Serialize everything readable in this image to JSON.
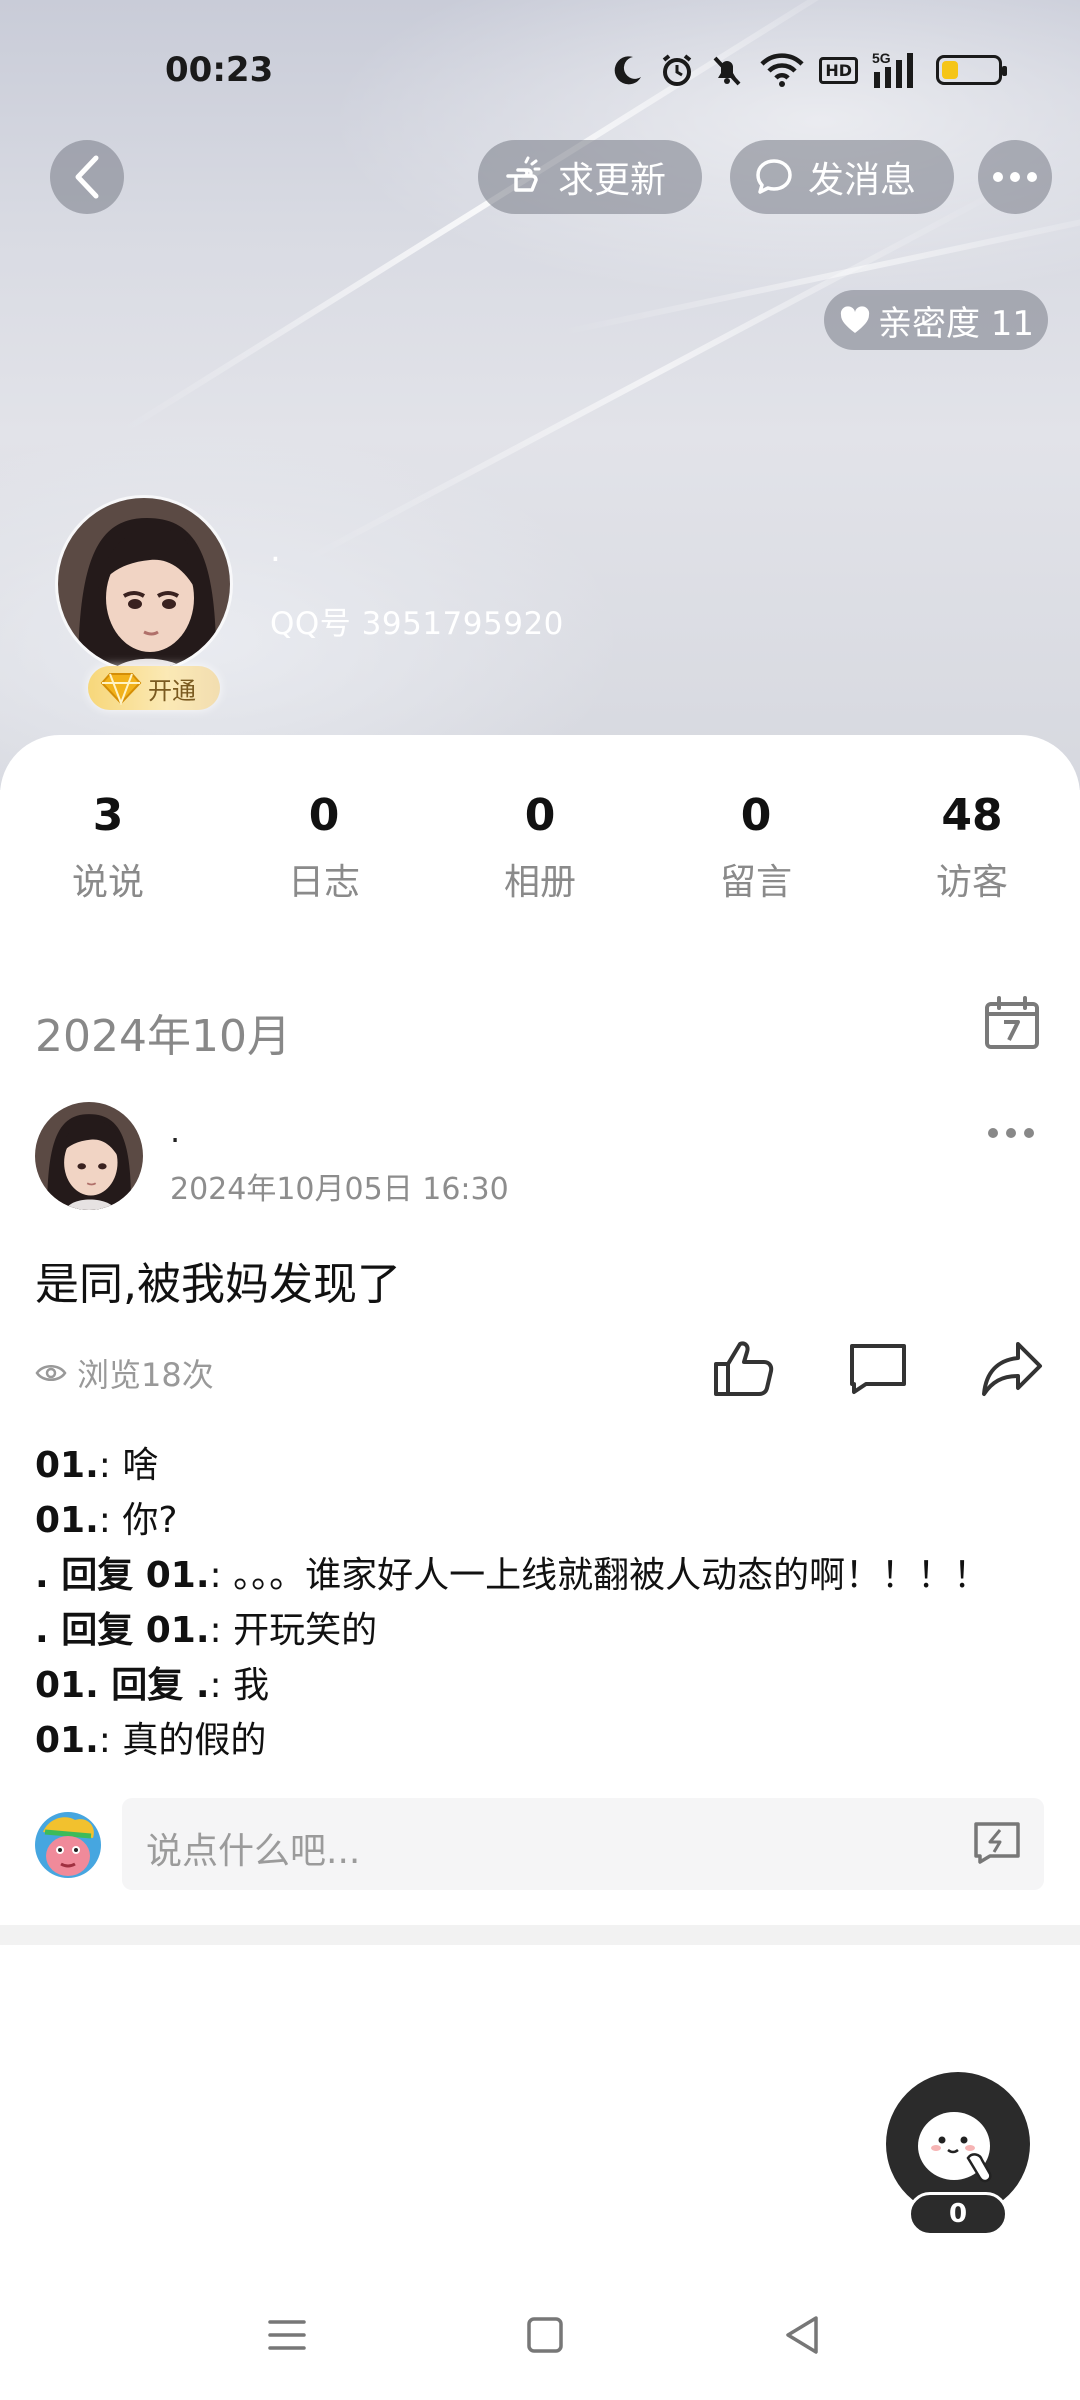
{
  "status_bar": {
    "time": "00:23",
    "icons": [
      "moon-icon",
      "alarm-icon",
      "mute-icon",
      "wifi-icon",
      "hd-icon",
      "5g-signal-icon",
      "battery-icon"
    ],
    "hd_label": "HD",
    "network_label": "5G",
    "battery_level": 0.3,
    "battery_color": "#f5c518"
  },
  "top_bar": {
    "request_update_label": "求更新",
    "send_message_label": "发消息"
  },
  "intimacy": {
    "label": "亲密度 11"
  },
  "profile": {
    "name": ".",
    "qq_number": "QQ号 3951795920",
    "vip_label": "开通"
  },
  "stats": [
    {
      "count": "3",
      "label": "说说"
    },
    {
      "count": "0",
      "label": "日志"
    },
    {
      "count": "0",
      "label": "相册"
    },
    {
      "count": "0",
      "label": "留言"
    },
    {
      "count": "48",
      "label": "访客"
    }
  ],
  "feed": {
    "month": "2024年10月",
    "post": {
      "author": ".",
      "time": "2024年10月05日 16:30",
      "text": "是同,被我妈发现了",
      "views": "浏览18次",
      "comments": [
        {
          "author": "01.",
          "text": "啥"
        },
        {
          "author": "01.",
          "text": "你?"
        },
        {
          "author": ". 回复 01.",
          "text": "。。。谁家好人一上线就翻被人动态的啊！！！！"
        },
        {
          "author": ". 回复 01.",
          "text": "开玩笑的"
        },
        {
          "author": "01. 回复 .",
          "text": "我"
        },
        {
          "author": "01.",
          "text": "真的假的"
        }
      ]
    },
    "comment_placeholder": "说点什么吧..."
  },
  "floating": {
    "count": "0"
  },
  "colors": {
    "accent_gray_button": "#787c87",
    "muted_text": "#8a8a8a",
    "vip_gold": "#f7d77a"
  }
}
